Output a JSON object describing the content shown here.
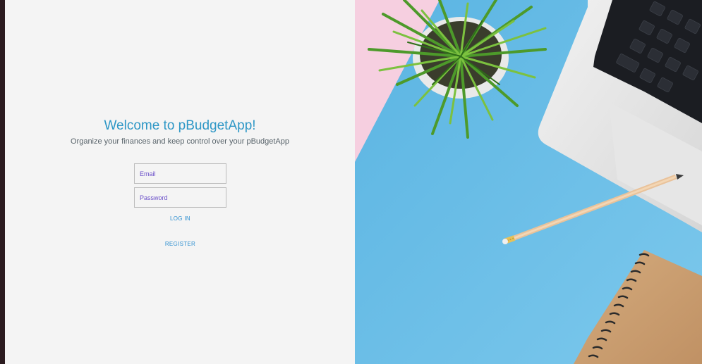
{
  "login": {
    "title": "Welcome to pBudgetApp!",
    "subtitle": "Organize your finances and keep control over your pBudgetApp",
    "email_placeholder": "Email",
    "password_placeholder": "Password",
    "login_label": "LOG IN",
    "register_label": "REGISTER"
  },
  "colors": {
    "title": "#2e97c6",
    "link": "#2e8fd0",
    "placeholder": "#6a4fc9",
    "panel_background": "#f4f4f4"
  },
  "hero_image": {
    "icon": "desk-flatlay-image",
    "contents": [
      "potted-plant-icon",
      "laptop-icon",
      "pencil-icon",
      "notebook-icon"
    ]
  }
}
